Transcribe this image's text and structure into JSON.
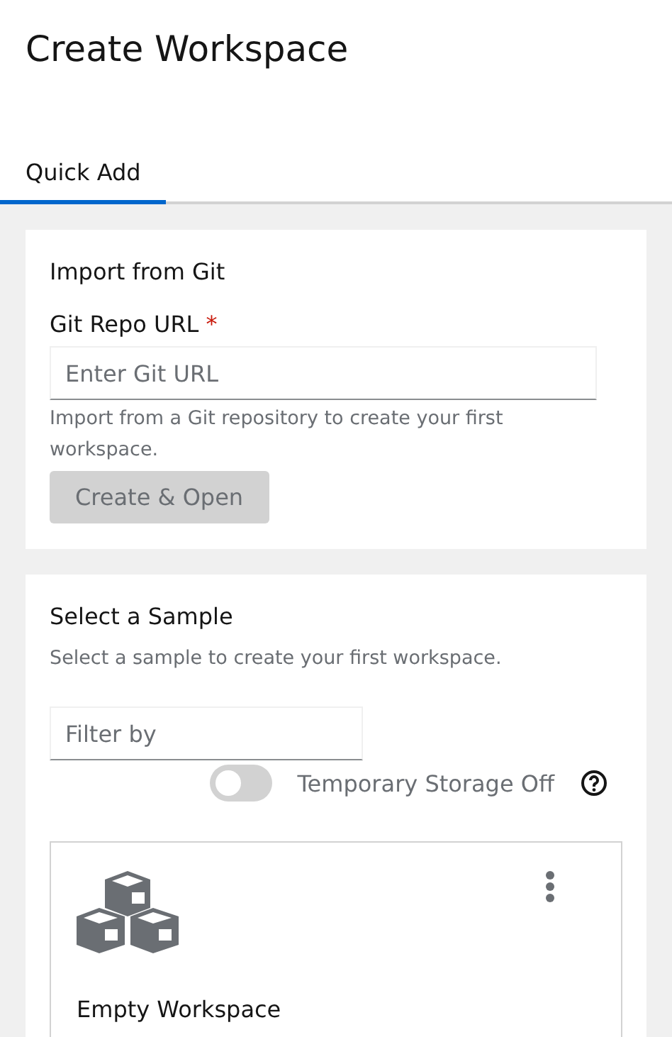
{
  "page": {
    "title": "Create Workspace"
  },
  "tabs": [
    {
      "label": "Quick Add",
      "selected": true
    }
  ],
  "import_card": {
    "title": "Import from Git",
    "field": {
      "label": "Git Repo URL",
      "required_mark": "*",
      "placeholder": "Enter Git URL",
      "helper": "Import from a Git repository to create your first workspace."
    },
    "button": {
      "label": "Create & Open",
      "disabled": true
    }
  },
  "sample_card": {
    "title": "Select a Sample",
    "description": "Select a sample to create your first workspace.",
    "filter": {
      "placeholder": "Filter by"
    },
    "storage_toggle": {
      "label": "Temporary Storage Off",
      "on": false
    },
    "samples": [
      {
        "name": "Empty Workspace"
      }
    ]
  }
}
